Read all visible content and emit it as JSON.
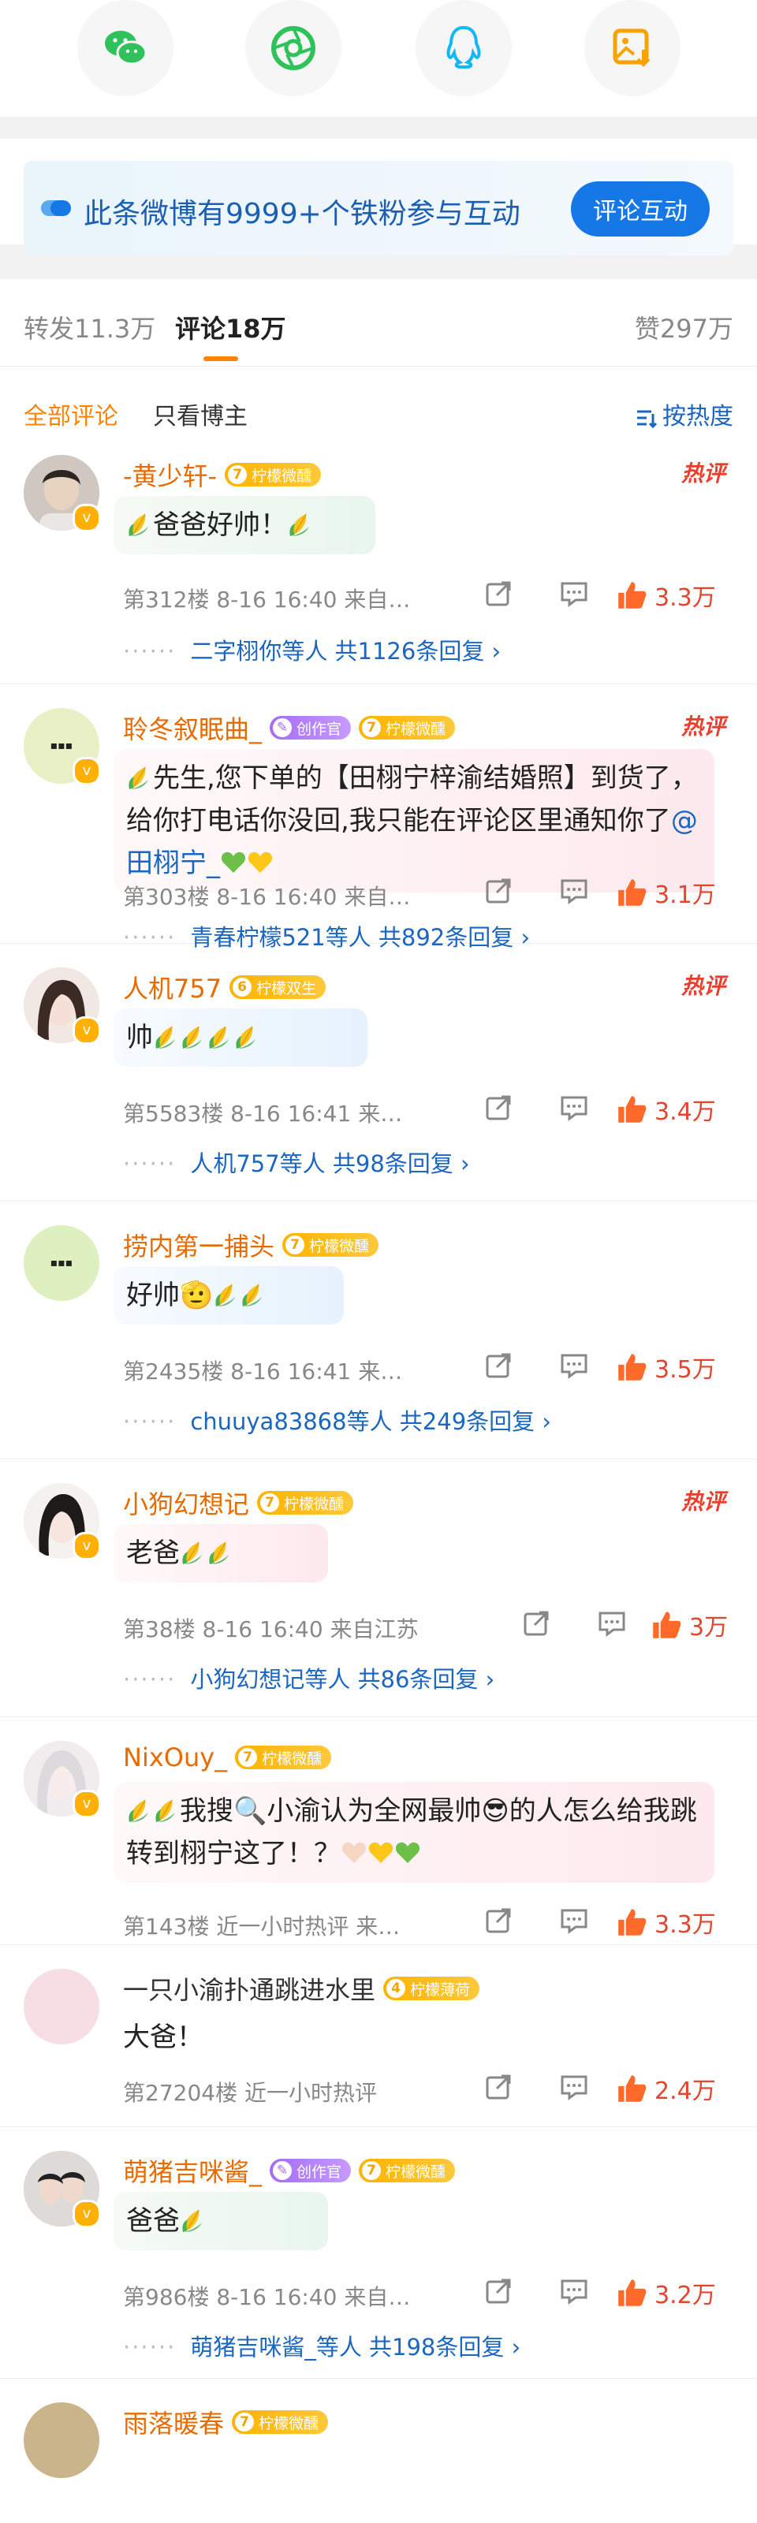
{
  "banner": {
    "text": "此条微博有9999+个铁粉参与互动",
    "button": "评论互动"
  },
  "stats": {
    "repost": "转发11.3万",
    "comments": "评论18万",
    "likes": "赞297万"
  },
  "filters": {
    "all": "全部评论",
    "author_only": "只看博主",
    "sort": "按热度"
  },
  "comments": [
    {
      "name": "-黄少轩-",
      "badges": [
        {
          "lv": "7",
          "text": "柠檬微醺"
        }
      ],
      "hot": "热评",
      "text": "爸爸好帅！",
      "meta": "第312楼 8-16 16:40 来自…",
      "likes": "3.3万",
      "thread": "二字栩你等人 共1126条回复 ›"
    },
    {
      "name": "聆冬叙眠曲_",
      "badges": [
        {
          "lv": "",
          "text": "创作官"
        },
        {
          "lv": "7",
          "text": "柠檬微醺"
        }
      ],
      "hot": "热评",
      "text_parts": [
        "先生,您下单的【田栩宁梓渝结婚照】到货了，给你打电话你没回,我只能在评论区里通知你了",
        "@田栩宁_"
      ],
      "meta": "第303楼 8-16 16:40 来自…",
      "likes": "3.1万",
      "thread": "青春柠檬521等人 共892条回复 ›"
    },
    {
      "name": "人机757",
      "badges": [
        {
          "lv": "6",
          "text": "柠檬双生"
        }
      ],
      "hot": "热评",
      "text": "帅",
      "meta": "第5583楼 8-16 16:41 来…",
      "likes": "3.4万",
      "thread": "人机757等人 共98条回复 ›"
    },
    {
      "name": "捞内第一捕头",
      "badges": [
        {
          "lv": "7",
          "text": "柠檬微醺"
        }
      ],
      "hot": "",
      "text": "好帅",
      "meta": "第2435楼 8-16 16:41 来…",
      "likes": "3.5万",
      "thread": "chuuya83868等人 共249条回复 ›"
    },
    {
      "name": "小狗幻想记",
      "badges": [
        {
          "lv": "7",
          "text": "柠檬微醺"
        }
      ],
      "hot": "热评",
      "text": "老爸",
      "meta": "第38楼 8-16 16:40 来自江苏",
      "likes": "3万",
      "thread": "小狗幻想记等人 共86条回复 ›"
    },
    {
      "name": "NixOuy_",
      "badges": [
        {
          "lv": "7",
          "text": "柠檬微醺"
        }
      ],
      "hot": "",
      "text_parts": [
        "我搜",
        "小渝认为全网最帅",
        "的人怎么给我跳转到栩宁这了！？"
      ],
      "meta": "第143楼 近一小时热评 来…",
      "likes": "3.3万",
      "thread": ""
    },
    {
      "name": "一只小渝扑通跳进水里",
      "badges": [
        {
          "lv": "4",
          "text": "柠檬薄荷"
        }
      ],
      "hot": "",
      "text": "大爸！",
      "meta": "第27204楼 近一小时热评",
      "likes": "2.4万",
      "thread": ""
    },
    {
      "name": "萌猪吉咪酱_",
      "badges": [
        {
          "lv": "",
          "text": "创作官"
        },
        {
          "lv": "7",
          "text": "柠檬微醺"
        }
      ],
      "hot": "",
      "text": "爸爸",
      "meta": "第986楼 8-16 16:40 来自…",
      "likes": "3.2万",
      "thread": "萌猪吉咪酱_等人 共198条回复 ›"
    },
    {
      "name": "雨落暖春",
      "badges": [
        {
          "lv": "7",
          "text": "柠檬微醺"
        }
      ],
      "hot": "",
      "text": "",
      "meta": "",
      "likes": "",
      "thread": ""
    }
  ],
  "colors": {
    "accent": "#ff8200",
    "link": "#1a66c0",
    "hot": "#e8402e",
    "banner_btn": "#1677e6"
  }
}
